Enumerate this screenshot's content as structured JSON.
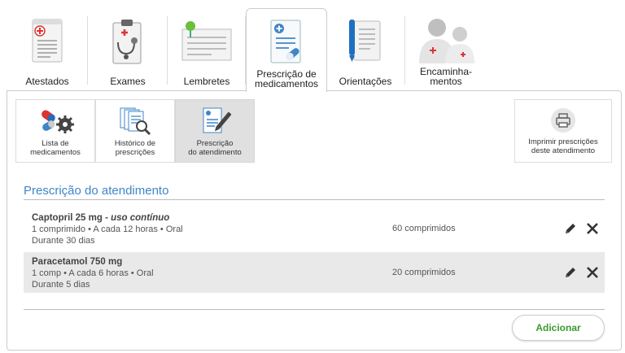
{
  "tabs": [
    {
      "label": "Atestados",
      "icon": "medical-certificate-icon"
    },
    {
      "label": "Exames",
      "icon": "clipboard-stethoscope-icon"
    },
    {
      "label": "Lembretes",
      "icon": "notepad-pin-icon"
    },
    {
      "label": "Prescrição de medicamentos",
      "icon": "prescription-pills-icon",
      "active": true
    },
    {
      "label": "Orientações",
      "icon": "document-pen-icon"
    },
    {
      "label": "Encaminha-mentos",
      "label_line1": "Encaminha-",
      "label_line2": "mentos",
      "icon": "doctors-icon"
    }
  ],
  "subtabs": [
    {
      "label_line1": "Lista de",
      "label_line2": "medicamentos",
      "icon": "pills-gear-icon"
    },
    {
      "label_line1": "Histórico de",
      "label_line2": "prescrições",
      "icon": "documents-search-icon"
    },
    {
      "label_line1": "Prescrição",
      "label_line2": "do atendimento",
      "icon": "document-pencil-icon",
      "active": true
    }
  ],
  "print": {
    "label_line1": "Imprimir prescrições",
    "label_line2": "deste atendimento",
    "icon": "printer-icon"
  },
  "section_title": "Prescrição do atendimento",
  "prescriptions": [
    {
      "name": "Captopril 25 mg",
      "note": " - uso contínuo",
      "dose": "1 comprimido • A cada 12 horas • Oral",
      "duration": "Durante 30 dias",
      "quantity": "60 comprimidos"
    },
    {
      "name": "Paracetamol 750 mg",
      "note": "",
      "dose": "1 comp • A cada 6 horas • Oral",
      "duration": "Durante 5 dias",
      "quantity": "20 comprimidos"
    }
  ],
  "add_label": "Adicionar",
  "colors": {
    "accent_blue": "#3f85c8",
    "add_green": "#3c9a2f",
    "row_alt": "#e9e9e9"
  }
}
